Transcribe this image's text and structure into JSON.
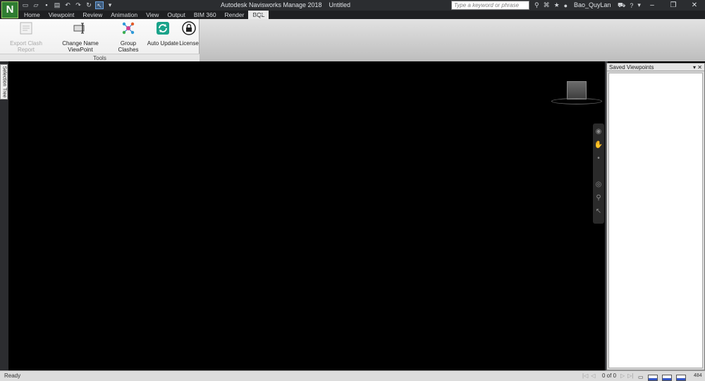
{
  "app": {
    "logo_letter": "N",
    "title": "Autodesk Navisworks Manage 2018",
    "document": "Untitled"
  },
  "search": {
    "placeholder": "Type a keyword or phrase"
  },
  "user": {
    "name": "Bao_QuyLan"
  },
  "quick_access_icons": [
    "new-icon",
    "open-icon",
    "save-icon",
    "print-icon",
    "undo-icon",
    "redo-icon",
    "refresh-icon",
    "select-icon"
  ],
  "tabs": [
    {
      "label": "Home"
    },
    {
      "label": "Viewpoint"
    },
    {
      "label": "Review"
    },
    {
      "label": "Animation"
    },
    {
      "label": "View"
    },
    {
      "label": "Output"
    },
    {
      "label": "BIM 360"
    },
    {
      "label": "Render"
    },
    {
      "label": "BQL",
      "active": true
    }
  ],
  "ribbon": {
    "panel_title": "Tools",
    "tools": [
      {
        "label": "Export Clash Report",
        "enabled": false
      },
      {
        "label": "Change Name ViewPoint",
        "enabled": true
      },
      {
        "label": "Group Clashes",
        "enabled": true
      },
      {
        "label": "Auto Update",
        "enabled": true
      },
      {
        "label": "License",
        "enabled": true
      }
    ]
  },
  "side_tabs": {
    "selection_tree": "Selection Tree"
  },
  "saved_viewpoints": {
    "title": "Saved Viewpoints"
  },
  "status": {
    "text": "Ready",
    "page": "0 of 0",
    "memory": "484"
  },
  "colors": {
    "titlebar": "#2b2d30",
    "viewport": "#000000",
    "active_tab": "#e9e9e9",
    "logo": "#2f7d32"
  }
}
